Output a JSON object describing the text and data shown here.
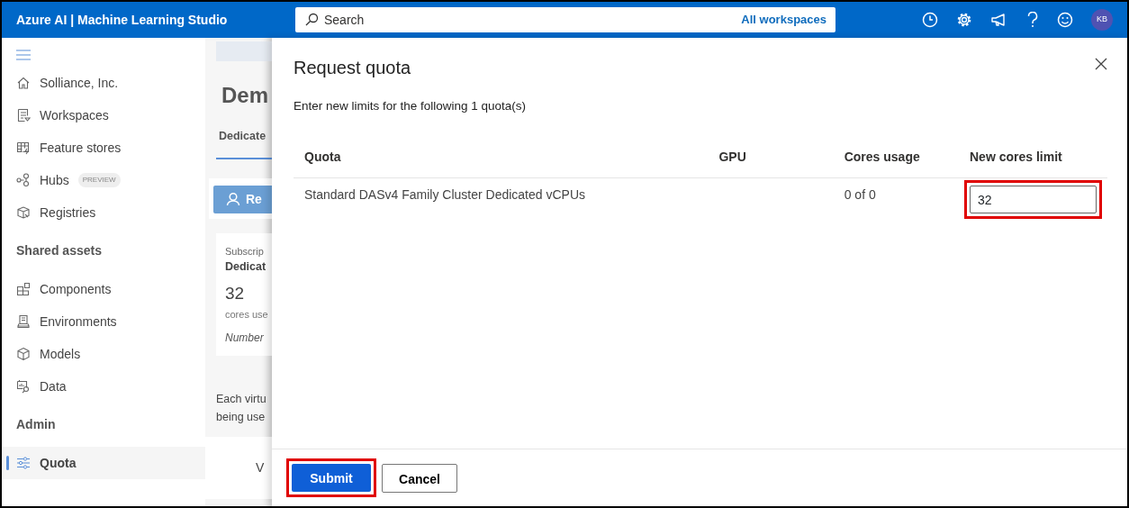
{
  "app": {
    "title": "Azure AI | Machine Learning Studio"
  },
  "search": {
    "placeholder": "Search",
    "scope": "All workspaces"
  },
  "user": {
    "initials": "KB"
  },
  "sidebar": {
    "sections": [
      {
        "items": [
          {
            "label": "Solliance, Inc.",
            "selected": false
          },
          {
            "label": "Workspaces",
            "selected": false
          },
          {
            "label": "Feature stores",
            "selected": false
          },
          {
            "label": "Hubs",
            "badge": "PREVIEW",
            "selected": false
          },
          {
            "label": "Registries",
            "selected": false
          }
        ]
      },
      {
        "heading": "Shared assets",
        "items": [
          {
            "label": "Components",
            "selected": false
          },
          {
            "label": "Environments",
            "selected": false
          },
          {
            "label": "Models",
            "selected": false
          },
          {
            "label": "Data",
            "selected": false
          }
        ]
      },
      {
        "heading": "Admin",
        "items": [
          {
            "label": "Quota",
            "selected": true
          }
        ]
      }
    ]
  },
  "background_page": {
    "title": "Dem",
    "tab": "Dedicate",
    "button": "Re",
    "card": {
      "label": "Subscrip",
      "name": "Dedicat",
      "value": "32",
      "unit": "cores use",
      "note": "Number"
    },
    "text": "Each virtu being use",
    "table_cell": "V"
  },
  "dialog": {
    "title": "Request quota",
    "description": "Enter new limits for the following 1 quota(s)",
    "columns": [
      "Quota",
      "GPU",
      "Cores usage",
      "New cores limit"
    ],
    "rows": [
      {
        "quota": "Standard DASv4 Family Cluster Dedicated vCPUs",
        "cores_usage": "0 of 0",
        "new_limit": "32",
        "highlighted": true
      }
    ],
    "buttons": [
      {
        "label": "Submit",
        "kind": "primary",
        "highlighted": true
      },
      {
        "label": "Cancel",
        "kind": "secondary",
        "highlighted": false
      }
    ]
  }
}
